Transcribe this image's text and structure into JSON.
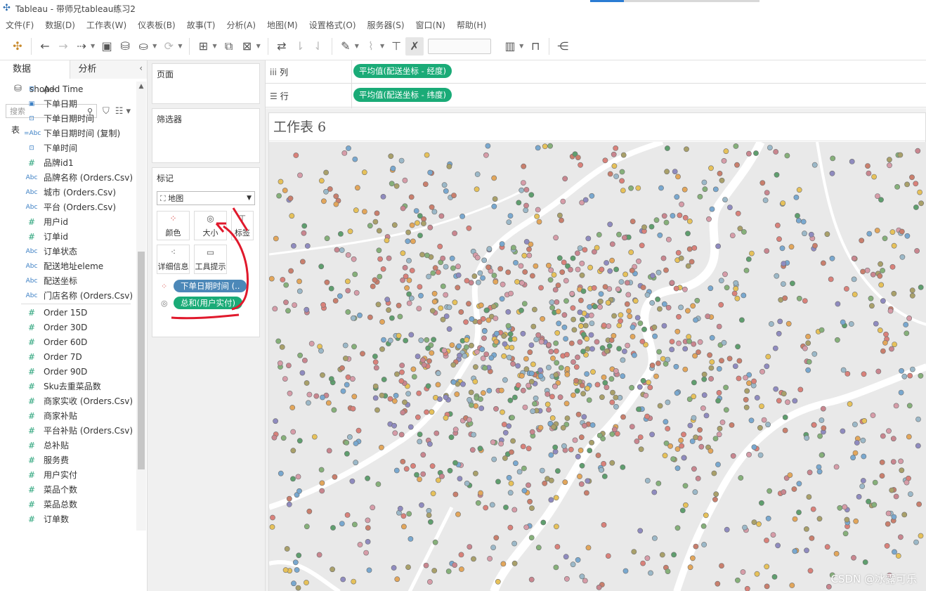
{
  "window": {
    "title": "Tableau - 带师兄tableau练习2"
  },
  "menubar": [
    "文件(F)",
    "数据(D)",
    "工作表(W)",
    "仪表板(B)",
    "故事(T)",
    "分析(A)",
    "地图(M)",
    "设置格式(O)",
    "服务器(S)",
    "窗口(N)",
    "帮助(H)"
  ],
  "left_panel": {
    "tabs": [
      "数据",
      "分析"
    ],
    "datasource": "shop+",
    "search_placeholder": "搜索",
    "section": "表",
    "fields": [
      {
        "type": "datetime",
        "name": "Add Time"
      },
      {
        "type": "date",
        "name": "下单日期"
      },
      {
        "type": "datetime",
        "name": "下单日期时间"
      },
      {
        "type": "calc-string",
        "name": "下单日期时间 (复制)"
      },
      {
        "type": "datetime",
        "name": "下单时间"
      },
      {
        "type": "number",
        "name": "品牌id1"
      },
      {
        "type": "string",
        "name": "品牌名称 (Orders.Csv)"
      },
      {
        "type": "string",
        "name": "城市 (Orders.Csv)"
      },
      {
        "type": "string",
        "name": "平台 (Orders.Csv)"
      },
      {
        "type": "number",
        "name": "用户id"
      },
      {
        "type": "number",
        "name": "订单id"
      },
      {
        "type": "string",
        "name": "订单状态"
      },
      {
        "type": "string",
        "name": "配送地址eleme"
      },
      {
        "type": "string",
        "name": "配送坐标"
      },
      {
        "type": "string",
        "name": "门店名称 (Orders.Csv)"
      }
    ],
    "measures": [
      "Order 15D",
      "Order 30D",
      "Order 60D",
      "Order 7D",
      "Order 90D",
      "Sku去重菜品数",
      "商家实收 (Orders.Csv)",
      "商家补贴",
      "平台补贴 (Orders.Csv)",
      "总补贴",
      "服务费",
      "用户实付",
      "菜品个数",
      "菜品总数",
      "订单数"
    ],
    "field_icons": {
      "date": "▣",
      "datetime": "⊡",
      "calc-string": "=Abc",
      "string": "Abc",
      "number": "#"
    }
  },
  "cards": {
    "pages_title": "页面",
    "filters_title": "筛选器",
    "marks_title": "标记",
    "mark_type": "地图",
    "buttons": [
      "颜色",
      "大小",
      "标签",
      "详细信息",
      "工具提示"
    ],
    "mark_pills": [
      "下单日期时间 (..",
      "总和(用户实付)"
    ]
  },
  "shelves": {
    "columns_label": "列",
    "rows_label": "行",
    "columns_pill": "平均值(配送坐标 - 经度)",
    "rows_pill": "平均值(配送坐标 - 纬度)"
  },
  "sheet": {
    "title": "工作表 6"
  },
  "watermark": "CSDN @冰露可乐",
  "colors": {
    "measure_pill": "#1aab77",
    "dimension_pill": "#4c88b8",
    "annotation": "#e0192c",
    "dot_palette": [
      "#d9817a",
      "#79a8cf",
      "#e2a65b",
      "#86b07a",
      "#c9868f",
      "#8f8bbf",
      "#e6c15a",
      "#5f9e6e",
      "#c97f6d",
      "#9bb8c8",
      "#d69ca8",
      "#a9a06a"
    ]
  }
}
